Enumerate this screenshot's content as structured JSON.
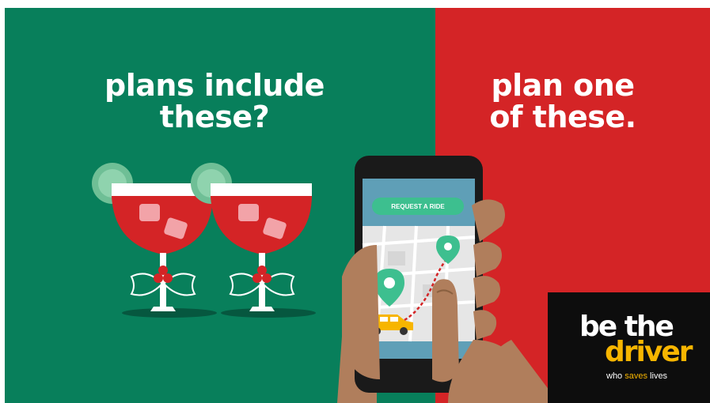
{
  "left_headline": {
    "line1": "plans include",
    "line2": "these?"
  },
  "right_headline": {
    "line1": "plan one",
    "line2": "of these."
  },
  "phone": {
    "request_button_label": "REQUEST A RIDE"
  },
  "badge": {
    "word1": "be the",
    "word2": "driver",
    "tag_prefix": "who ",
    "tag_highlight": "saves",
    "tag_suffix": " lives"
  },
  "colors": {
    "left_background": "#087f5b",
    "right_background": "#d42426",
    "badge_background": "#0d0d0d",
    "accent_yellow": "#f7b500",
    "phone_screen": "#5f9fb7",
    "map_pin": "#3dbf8f",
    "drink_red": "#d42426",
    "skin": "#b07e5c"
  },
  "icons": [
    "cocktail-glass-icon",
    "lime-garnish-icon",
    "holly-icon",
    "smartphone-icon",
    "map-pin-icon",
    "taxi-car-icon",
    "hand-icon"
  ]
}
